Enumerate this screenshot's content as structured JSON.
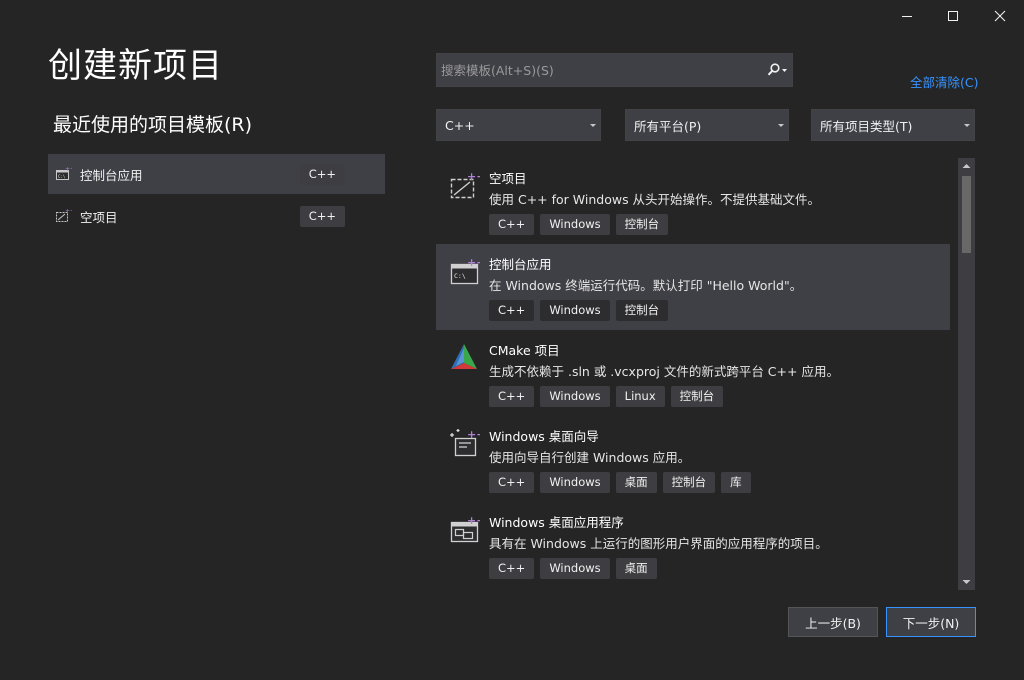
{
  "window": {
    "controls": [
      "minimize",
      "maximize",
      "close"
    ]
  },
  "header": {
    "title": "创建新项目",
    "recent_title": "最近使用的项目模板",
    "recent_title_hotkey": "(R)"
  },
  "recent": {
    "items": [
      {
        "label": "控制台应用",
        "badge": "C++",
        "icon": "console-app-icon",
        "selected": true
      },
      {
        "label": "空项目",
        "badge": "C++",
        "icon": "empty-project-icon",
        "selected": false
      }
    ]
  },
  "search": {
    "placeholder": "搜索模板(Alt+S)(S)",
    "value": ""
  },
  "filters": {
    "clear_all": "全部清除(C)",
    "language": {
      "label": "C++"
    },
    "platform": {
      "label": "所有平台(P)"
    },
    "project_type": {
      "label": "所有项目类型(T)"
    }
  },
  "templates": [
    {
      "title": "空项目",
      "desc": "使用 C++ for Windows 从头开始操作。不提供基础文件。",
      "tags": [
        "C++",
        "Windows",
        "控制台"
      ],
      "icon": "empty-project-icon",
      "selected": false
    },
    {
      "title": "控制台应用",
      "desc": "在 Windows 终端运行代码。默认打印 \"Hello World\"。",
      "tags": [
        "C++",
        "Windows",
        "控制台"
      ],
      "icon": "console-app-icon",
      "selected": true
    },
    {
      "title": "CMake 项目",
      "desc": "生成不依赖于 .sln 或 .vcxproj 文件的新式跨平台 C++ 应用。",
      "tags": [
        "C++",
        "Windows",
        "Linux",
        "控制台"
      ],
      "icon": "cmake-icon",
      "selected": false
    },
    {
      "title": "Windows 桌面向导",
      "desc": "使用向导自行创建 Windows 应用。",
      "tags": [
        "C++",
        "Windows",
        "桌面",
        "控制台",
        "库"
      ],
      "icon": "desktop-wizard-icon",
      "selected": false
    },
    {
      "title": "Windows 桌面应用程序",
      "desc": "具有在 Windows 上运行的图形用户界面的应用程序的项目。",
      "tags": [
        "C++",
        "Windows",
        "桌面"
      ],
      "icon": "desktop-app-icon",
      "selected": false
    }
  ],
  "buttons": {
    "back": "上一步(B)",
    "next": "下一步(N)"
  },
  "colors": {
    "background": "#252526",
    "panel": "#3f3f46",
    "tag": "#3e3e42",
    "accent": "#3794ff",
    "purple_plus": "#b180d7"
  }
}
